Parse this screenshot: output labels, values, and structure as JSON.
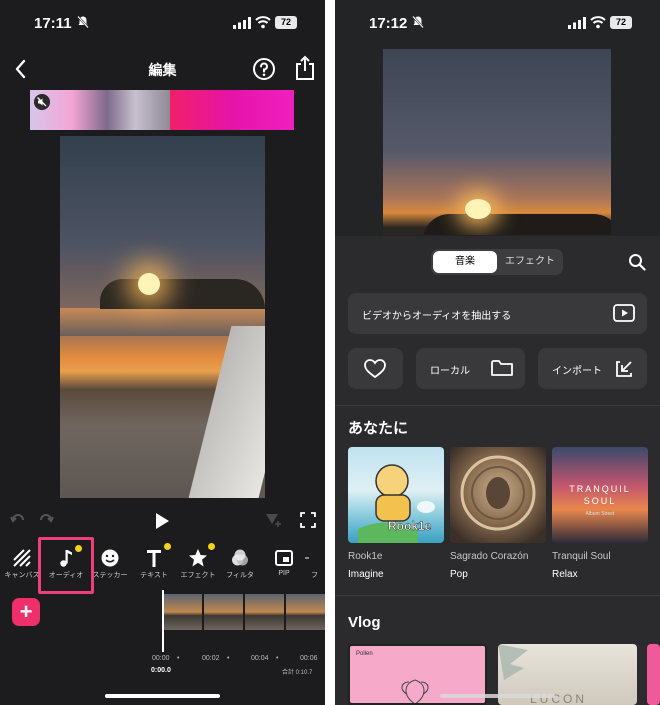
{
  "left": {
    "status": {
      "time": "17:11",
      "battery": "72"
    },
    "nav": {
      "title": "編集"
    },
    "tools": [
      {
        "label": "キャンバス",
        "icon": "canvas-icon"
      },
      {
        "label": "オーディオ",
        "icon": "music-note-icon",
        "badge": true
      },
      {
        "label": "ステッカー",
        "icon": "sticker-icon"
      },
      {
        "label": "テキスト",
        "icon": "text-icon",
        "badge": true
      },
      {
        "label": "エフェクト",
        "icon": "star-icon",
        "badge": true
      },
      {
        "label": "フィルタ",
        "icon": "filter-icon"
      },
      {
        "label": "PIP",
        "icon": "pip-icon"
      },
      {
        "label": "フ",
        "icon": "more-icon"
      }
    ],
    "timeline": {
      "ticks": [
        "00:00",
        "00:02",
        "00:04",
        "00:06"
      ],
      "current": "0:00.0",
      "total": "合計 0:10.7"
    }
  },
  "right": {
    "status": {
      "time": "17:12",
      "battery": "72"
    },
    "tabs": {
      "music": "音楽",
      "effect": "エフェクト"
    },
    "extract_label": "ビデオからオーディオを抽出する",
    "local_label": "ローカル",
    "import_label": "インポート",
    "for_you_title": "あなたに",
    "for_you": [
      {
        "title": "Rook1e",
        "genre": "Imagine",
        "cover_text": "Rook1e"
      },
      {
        "title": "Sagrado Corazón",
        "genre": "Pop"
      },
      {
        "title": "Tranquil Soul",
        "genre": "Relax",
        "cover_text": "TRANQUIL SOUL",
        "cover_sub": "Album Street"
      }
    ],
    "vlog_title": "Vlog",
    "vlog_cards": [
      {
        "cover_text": "Pollen"
      },
      {
        "cover_text": "LUCON"
      }
    ]
  },
  "colors": {
    "accent": "#ef2f6c",
    "badge": "#f4d21c"
  }
}
